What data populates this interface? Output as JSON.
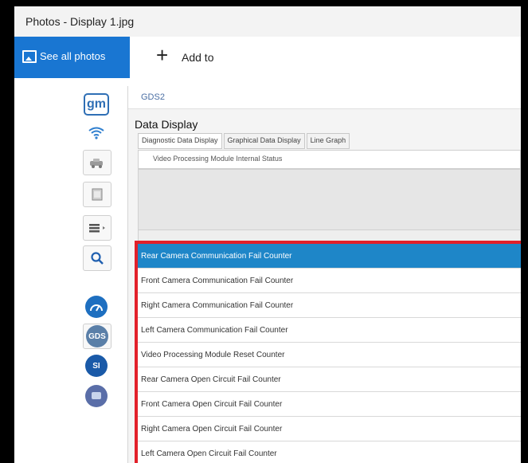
{
  "window": {
    "title": "Photos - Display 1.jpg"
  },
  "toolbar": {
    "see_all_label": "See all photos",
    "add_to_label": "Add to",
    "add_icon": "+"
  },
  "sidebar": {
    "gm_label": "gm",
    "gds_badge": "GDS",
    "si_badge": "SI"
  },
  "gds": {
    "header": "GDS2",
    "title": "Data Display",
    "tabs": [
      "Diagnostic Data Display",
      "Graphical Data Display",
      "Line Graph"
    ],
    "submodule": "Video Processing Module Internal Status"
  },
  "list": {
    "items": [
      "Rear Camera Communication Fail Counter",
      "Front Camera Communication Fail Counter",
      "Right Camera Communication Fail Counter",
      "Left Camera Communication Fail Counter",
      "Video Processing Module Reset Counter",
      "Rear Camera Open Circuit Fail Counter",
      "Front Camera Open Circuit Fail Counter",
      "Right Camera Open Circuit Fail Counter",
      "Left Camera Open Circuit Fail Counter"
    ],
    "selected_index": 0
  },
  "colors": {
    "accent": "#1976d2",
    "highlight": "#e2202a",
    "selected_row": "#1e86c8"
  }
}
